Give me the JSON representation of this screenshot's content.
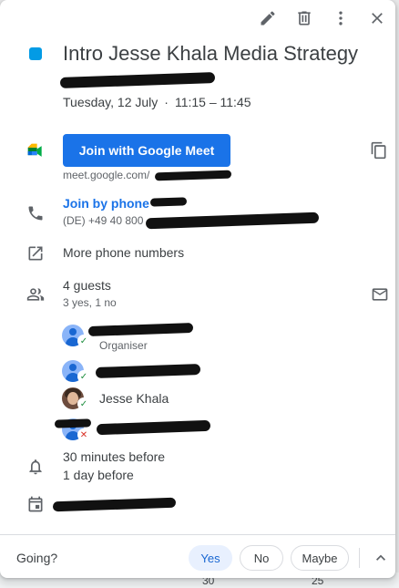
{
  "event": {
    "title": "Intro Jesse Khala Media Strategy",
    "color": "#039be5",
    "date": "Tuesday, 12 July",
    "separator": "·",
    "time": "11:15 – 11:45"
  },
  "toolbar": {
    "edit_icon": "pencil-icon",
    "delete_icon": "trash-icon",
    "more_icon": "more-vert-icon",
    "close_icon": "close-icon"
  },
  "meet": {
    "button_label": "Join with Google Meet",
    "link": "meet.google.com/"
  },
  "phone": {
    "link_label": "Join by phone",
    "number": "(DE) +49 40 800"
  },
  "more_phone_numbers": "More phone numbers",
  "guests": {
    "count_label": "4 guests",
    "summary": "3 yes, 1 no",
    "list": [
      {
        "name": "",
        "role": "Organiser",
        "status": "yes"
      },
      {
        "name": "",
        "role": "",
        "status": "yes"
      },
      {
        "name": "Jesse Khala",
        "role": "",
        "status": "yes"
      },
      {
        "name": "",
        "role": "",
        "status": "no"
      }
    ]
  },
  "reminders": [
    "30 minutes before",
    "1 day before"
  ],
  "footer": {
    "going_label": "Going?",
    "yes": "Yes",
    "no": "No",
    "maybe": "Maybe",
    "selected": "Yes"
  },
  "background_calendar": {
    "dates": [
      "30",
      "25"
    ]
  },
  "colors": {
    "accent": "#1a73e8",
    "yes_green": "#1e8e3e",
    "no_red": "#d93025"
  }
}
